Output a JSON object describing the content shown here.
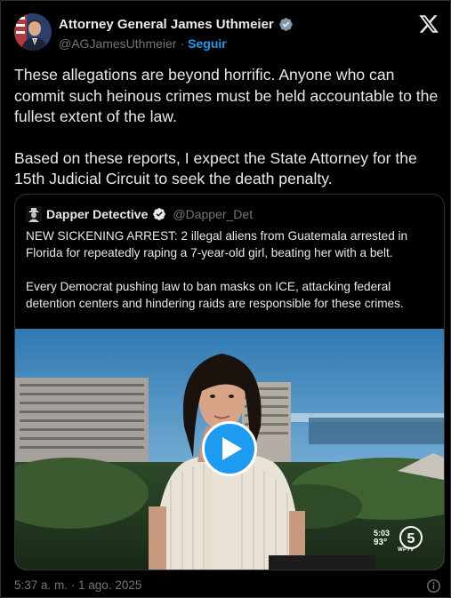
{
  "author": {
    "display_name": "Attorney General James Uthmeier",
    "handle": "@AGJamesUthmeier",
    "separator": "·",
    "follow_label": "Seguir",
    "verified_icon": "verified-badge-icon",
    "platform_icon": "x-logo-icon"
  },
  "tweet": {
    "paragraphs": [
      "These allegations are beyond horrific. Anyone who can commit such heinous crimes must be held accountable to the fullest extent of the law.",
      "Based on these reports, I expect the State Attorney for the 15th Judicial Circuit to seek the death penalty."
    ]
  },
  "quoted": {
    "display_name": "Dapper Detective",
    "handle": "@Dapper_Det",
    "paragraphs": [
      "NEW SICKENING ARREST: 2 illegal aliens from Guatemala arrested in Florida for repeatedly raping a 7-year-old girl, beating her with a belt.",
      "Every Democrat pushing law to ban masks on ICE, attacking federal detention centers and hindering raids are responsible for these crimes."
    ],
    "media": {
      "overlay_time": "5:03",
      "overlay_temp": "93°",
      "station_number": "5",
      "station_label": "WPTV",
      "play_icon": "play-icon"
    }
  },
  "footer": {
    "timestamp": "5:37 a. m. · 1 ago. 2025",
    "info_icon": "info-icon"
  },
  "colors": {
    "background": "#000000",
    "text": "#e7e9ea",
    "muted": "#71767b",
    "accent": "#1d9bf0",
    "border": "#2f3336"
  }
}
